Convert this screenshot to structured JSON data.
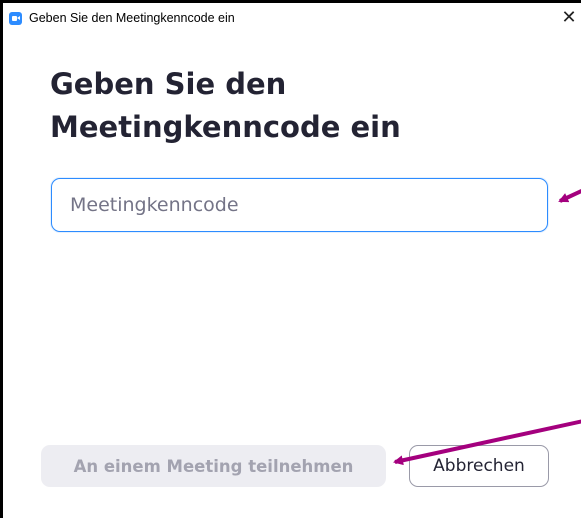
{
  "window": {
    "title": "Geben Sie den Meetingkenncode ein",
    "app_icon": "zoom-video-icon",
    "close_glyph": "✕"
  },
  "dialog": {
    "heading": "Geben Sie den Meetingkenncode ein",
    "passcode_input": {
      "value": "",
      "placeholder": "Meetingkenncode"
    },
    "join_button_label": "An einem Meeting teilnehmen",
    "cancel_button_label": "Abbrechen"
  },
  "colors": {
    "accent": "#2d8cff",
    "heading_text": "#232333",
    "disabled_button_bg": "#ededf2",
    "disabled_button_text": "#a3a3b0",
    "annotation_arrow": "#a4007e"
  }
}
